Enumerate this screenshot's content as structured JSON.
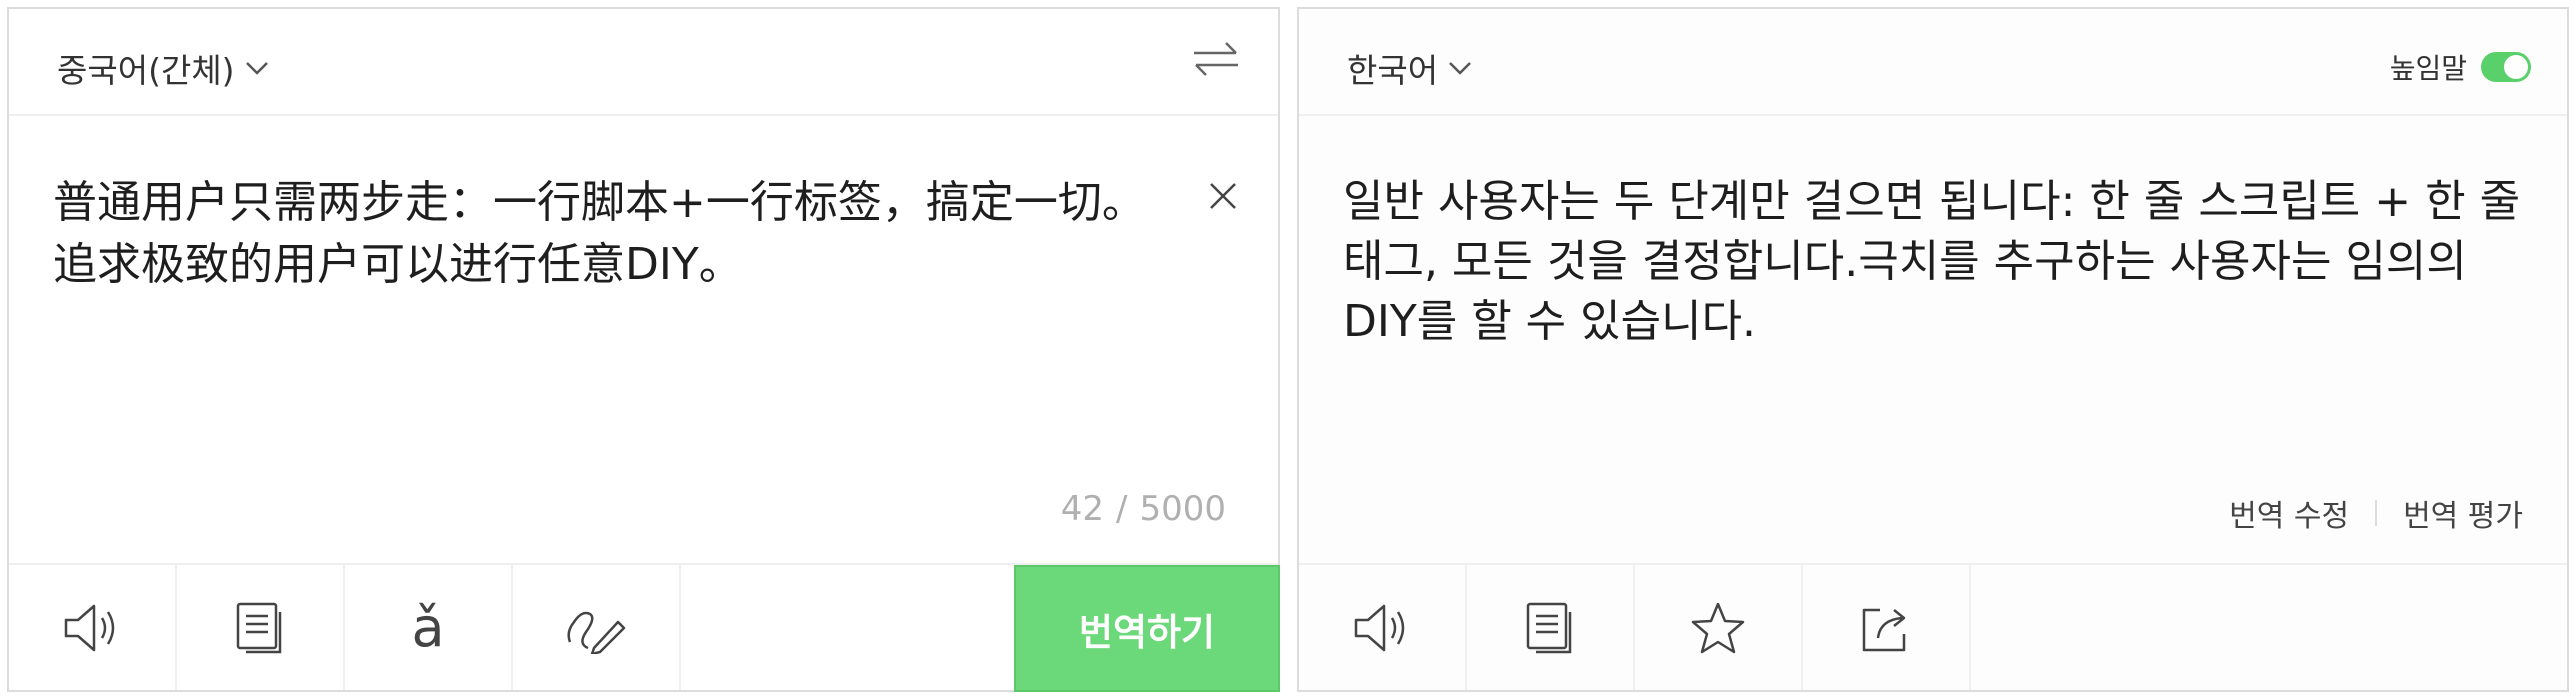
{
  "source": {
    "language": "중국어(간체)",
    "text": "普通用户只需两步走：一行脚本+一行标签，搞定一切。追求极致的用户可以进行任意DIY。",
    "char_count": "42",
    "char_limit": "5000",
    "count_sep": "/",
    "translate_button": "번역하기",
    "footer_icons": [
      "speaker-icon",
      "copy-icon",
      "pinyin-icon",
      "handwriting-icon"
    ],
    "pinyin_glyph": "ǎ"
  },
  "target": {
    "language": "한국어",
    "honorific_label": "높임말",
    "honorific_on": true,
    "text": "일반 사용자는 두 단계만 걸으면 됩니다: 한 줄 스크립트 + 한 줄 태그, 모든 것을 결정합니다.극치를 추구하는 사용자는 임의의 DIY를 할 수 있습니다.",
    "edit_translation": "번역 수정",
    "rate_translation": "번역 평가",
    "footer_icons": [
      "speaker-icon",
      "copy-icon",
      "star-icon",
      "share-icon"
    ]
  },
  "colors": {
    "accent_green": "#6bd879",
    "toggle_green": "#5ad06a",
    "border": "#dcdcdc",
    "muted_text": "#b0b0b0"
  }
}
